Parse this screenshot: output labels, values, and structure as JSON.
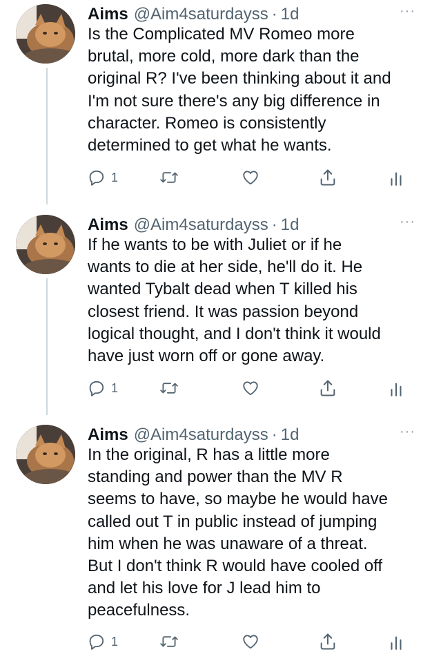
{
  "tweets": [
    {
      "name": "Aims",
      "handle": "@Aim4saturdayss",
      "separator": "·",
      "time": "1d",
      "more": "···",
      "text": "Is the Complicated MV Romeo more\nbrutal, more cold, more dark than the\noriginal R? I've been thinking about it and\nI'm not sure there's any big difference in\ncharacter. Romeo is consistently\ndetermined to get what he wants.",
      "reply_count": "1",
      "icons": [
        "reply-icon",
        "retweet-icon",
        "like-icon",
        "share-icon",
        "analytics-icon"
      ]
    },
    {
      "name": "Aims",
      "handle": "@Aim4saturdayss",
      "separator": "·",
      "time": "1d",
      "more": "···",
      "text": "If he wants to be with Juliet or if he\nwants to die at her side, he'll do it. He\nwanted Tybalt dead when T killed his\nclosest friend. It was passion beyond\nlogical thought, and I don't think it would\nhave just worn off or gone away.",
      "reply_count": "1",
      "icons": [
        "reply-icon",
        "retweet-icon",
        "like-icon",
        "share-icon",
        "analytics-icon"
      ]
    },
    {
      "name": "Aims",
      "handle": "@Aim4saturdayss",
      "separator": "·",
      "time": "1d",
      "more": "···",
      "text": "In the original, R has a little more\nstanding and power than the MV R\nseems to have, so maybe he would have\ncalled out T in public instead of jumping\nhim when he was unaware of a threat.\nBut I don't think R would have cooled off\nand let his love for J lead him to\npeacefulness.",
      "reply_count": "1",
      "icons": [
        "reply-icon",
        "retweet-icon",
        "like-icon",
        "share-icon",
        "analytics-icon"
      ]
    }
  ],
  "colors": {
    "text": "#0f1419",
    "secondary": "#536471",
    "thread_line": "#cfd9de",
    "icon": "#536471"
  }
}
